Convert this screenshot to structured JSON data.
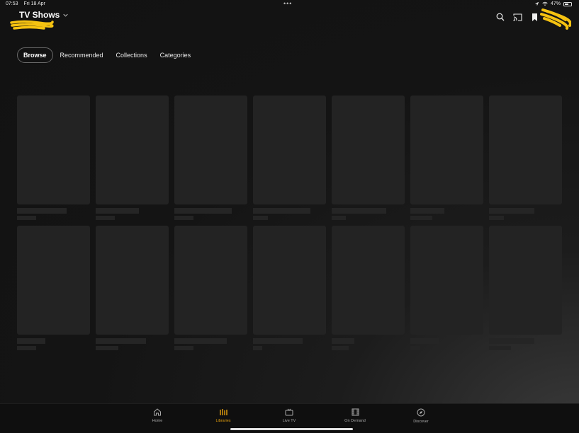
{
  "status_bar": {
    "time": "07:53",
    "date": "Fri 18 Apr",
    "dots": "•••",
    "battery": "47%",
    "battery_level": 0.47
  },
  "header": {
    "title": "TV Shows",
    "icons": [
      "search-icon",
      "cast-icon",
      "bookmark-icon",
      "chevron-down-icon"
    ]
  },
  "tabs": [
    "Browse",
    "Recommended",
    "Collections",
    "Categories"
  ],
  "grid": {
    "placeholder_rows": [
      [
        [
          70,
          27
        ],
        [
          61,
          27
        ],
        [
          81,
          27
        ],
        [
          81,
          21
        ],
        [
          77,
          20
        ],
        [
          48,
          31
        ],
        [
          64,
          21
        ]
      ],
      [
        [
          40,
          27
        ],
        [
          71,
          32
        ],
        [
          74,
          27
        ],
        [
          70,
          13
        ],
        [
          32,
          24
        ],
        [
          40,
          14
        ],
        [
          64,
          31
        ]
      ]
    ]
  },
  "bottom_nav": {
    "items": [
      {
        "label": "Home",
        "icon": "home-icon"
      },
      {
        "label": "Libraries",
        "icon": "libraries-icon"
      },
      {
        "label": "Live TV",
        "icon": "tv-icon"
      },
      {
        "label": "On Demand",
        "icon": "film-icon"
      },
      {
        "label": "Discover",
        "icon": "compass-icon"
      }
    ]
  },
  "accent_color": "#e5a00d"
}
